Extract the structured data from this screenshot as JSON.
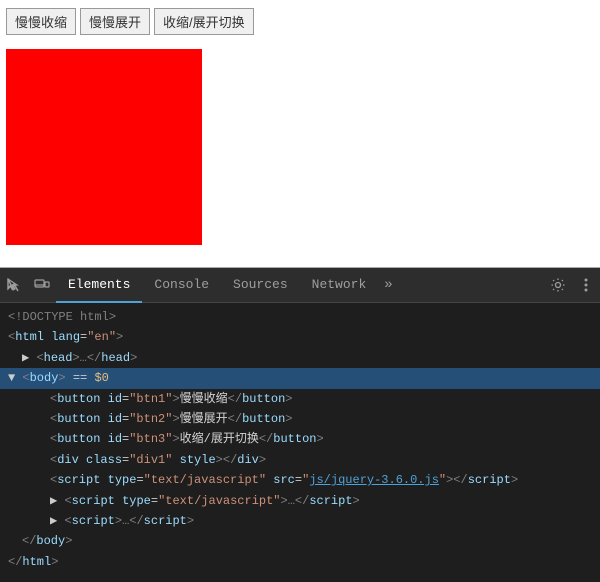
{
  "buttons": {
    "btn1": "慢慢收缩",
    "btn2": "慢慢展开",
    "btn3": "收缩/展开切换"
  },
  "devtools": {
    "tabs": [
      {
        "id": "elements",
        "label": "Elements",
        "active": true
      },
      {
        "id": "console",
        "label": "Console"
      },
      {
        "id": "sources",
        "label": "Sources"
      },
      {
        "id": "network",
        "label": "Network"
      }
    ],
    "code_lines": [
      {
        "indent": 0,
        "content": "<!DOCTYPE html>"
      },
      {
        "indent": 0,
        "content": "<html lang=\"en\">"
      },
      {
        "indent": 1,
        "content": "▶ <head>…</head>"
      },
      {
        "indent": 0,
        "body": true,
        "content": "▼ <body> == $0"
      },
      {
        "indent": 2,
        "content": "<button id=\"btn1\">慢慢收缩</button>"
      },
      {
        "indent": 2,
        "content": "<button id=\"btn2\">慢慢展开</button>"
      },
      {
        "indent": 2,
        "content": "<button id=\"btn3\">收缩/展开切换</button>"
      },
      {
        "indent": 2,
        "content": "<div class=\"div1\" style></div>"
      },
      {
        "indent": 2,
        "content": "<script type=\"text/javascript\" src=\"js/jquery-3.6.0.js\"></script>"
      },
      {
        "indent": 2,
        "content": "▶ <script type=\"text/javascript\">…</script>"
      },
      {
        "indent": 2,
        "content": "▶ <script>…</script>"
      },
      {
        "indent": 1,
        "content": "</body>"
      },
      {
        "indent": 0,
        "content": "</html>"
      }
    ]
  }
}
